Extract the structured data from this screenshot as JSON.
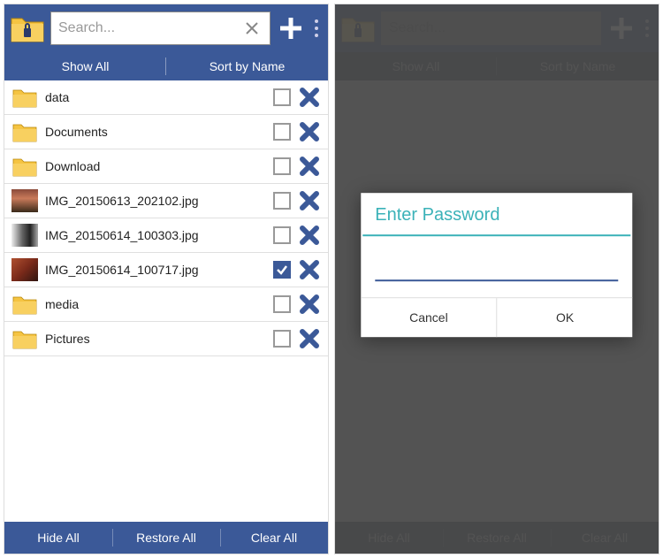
{
  "colors": {
    "accent": "#3b5998",
    "teal": "#3bb2b8"
  },
  "search": {
    "placeholder": "Search..."
  },
  "subheader": {
    "show_all": "Show All",
    "sort": "Sort by Name"
  },
  "footer": {
    "hide": "Hide All",
    "restore": "Restore All",
    "clear": "Clear All"
  },
  "dialog": {
    "title": "Enter Password",
    "cancel": "Cancel",
    "ok": "OK"
  },
  "items": [
    {
      "name": "data",
      "type": "folder",
      "checked": false
    },
    {
      "name": "Documents",
      "type": "folder",
      "checked": false
    },
    {
      "name": "Download",
      "type": "folder",
      "checked": false
    },
    {
      "name": "IMG_20150613_202102.jpg",
      "type": "image",
      "thumb": "img-thumb-1",
      "checked": false
    },
    {
      "name": "IMG_20150614_100303.jpg",
      "type": "image",
      "thumb": "img-thumb-2",
      "checked": false
    },
    {
      "name": "IMG_20150614_100717.jpg",
      "type": "image",
      "thumb": "img-thumb-3",
      "checked": true
    },
    {
      "name": "media",
      "type": "folder",
      "checked": false
    },
    {
      "name": "Pictures",
      "type": "folder",
      "checked": false
    }
  ]
}
